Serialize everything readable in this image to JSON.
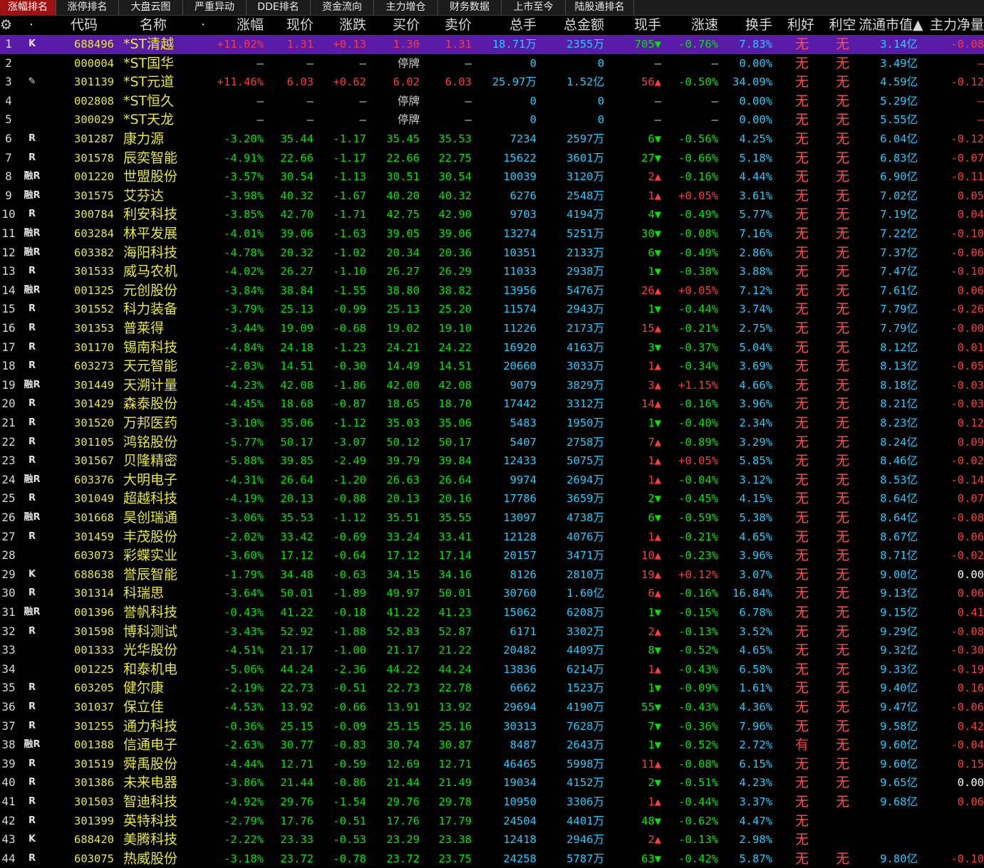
{
  "tabs": [
    {
      "label": "涨幅排名",
      "active": true
    },
    {
      "label": "涨停排名",
      "active": false
    },
    {
      "label": "大盘云图",
      "active": false
    },
    {
      "label": "严重异动",
      "active": false
    },
    {
      "label": "DDE排名",
      "active": false
    },
    {
      "label": "资金流向",
      "active": false
    },
    {
      "label": "主力增仓",
      "active": false
    },
    {
      "label": "财务数据",
      "active": false
    },
    {
      "label": "上市至今",
      "active": false
    },
    {
      "label": "陆股通排名",
      "active": false
    }
  ],
  "header": {
    "settings_icon": "gear-icon",
    "columns": [
      "",
      "·",
      "代码",
      "名称",
      "·",
      "涨幅",
      "现价",
      "涨跌",
      "买价",
      "卖价",
      "总手",
      "总金额",
      "现手",
      "涨速",
      "换手",
      "利好",
      "利空",
      "流通市值▲",
      "主力净量"
    ]
  },
  "colors": {
    "up": "#ff3838",
    "down": "#00e600",
    "code": "#e8e838",
    "name": "#e8e838",
    "value": "#22ccff",
    "flat": "#d0d0d0",
    "selected_bg": "#5a1ba8",
    "active_tab": "#9e1212"
  },
  "rows": [
    [
      "1",
      "K",
      "688496",
      "*ST清越",
      "+11.02%",
      "1.31",
      "+0.13",
      "1.30",
      "1.31",
      "18.71万",
      "2355万",
      "705▼",
      "-0.76%",
      "7.83%",
      "无",
      "无",
      "3.14亿",
      "-0.08"
    ],
    [
      "2",
      "",
      "000004",
      "*ST国华",
      "—",
      "—",
      "—",
      "停牌",
      "—",
      "0",
      "0",
      "—",
      "—",
      "0.00%",
      "无",
      "无",
      "3.49亿",
      "—"
    ],
    [
      "3",
      "✎",
      "301139",
      "*ST元道",
      "+11.46%",
      "6.03",
      "+0.62",
      "6.02",
      "6.03",
      "25.97万",
      "1.52亿",
      "56▲",
      "-0.50%",
      "34.09%",
      "无",
      "无",
      "4.59亿",
      "-0.12"
    ],
    [
      "4",
      "",
      "002808",
      "*ST恒久",
      "—",
      "—",
      "—",
      "停牌",
      "—",
      "0",
      "0",
      "—",
      "—",
      "0.00%",
      "无",
      "无",
      "5.29亿",
      "—"
    ],
    [
      "5",
      "",
      "300029",
      "*ST天龙",
      "—",
      "—",
      "—",
      "停牌",
      "—",
      "0",
      "0",
      "—",
      "—",
      "0.00%",
      "无",
      "无",
      "5.55亿",
      "—"
    ],
    [
      "6",
      "R",
      "301287",
      "康力源",
      "-3.20%",
      "35.44",
      "-1.17",
      "35.45",
      "35.53",
      "7234",
      "2597万",
      "6▼",
      "-0.56%",
      "4.25%",
      "无",
      "无",
      "6.04亿",
      "-0.12"
    ],
    [
      "7",
      "R",
      "301578",
      "辰奕智能",
      "-4.91%",
      "22.66",
      "-1.17",
      "22.66",
      "22.75",
      "15622",
      "3601万",
      "27▼",
      "-0.66%",
      "5.18%",
      "无",
      "无",
      "6.83亿",
      "-0.07"
    ],
    [
      "8",
      "融R",
      "001220",
      "世盟股份",
      "-3.57%",
      "30.54",
      "-1.13",
      "30.51",
      "30.54",
      "10039",
      "3120万",
      "2▲",
      "-0.16%",
      "4.44%",
      "无",
      "无",
      "6.90亿",
      "-0.11"
    ],
    [
      "9",
      "融R",
      "301575",
      "艾芬达",
      "-3.98%",
      "40.32",
      "-1.67",
      "40.20",
      "40.32",
      "6276",
      "2548万",
      "1▲",
      "+0.05%",
      "3.61%",
      "无",
      "无",
      "7.02亿",
      "0.05"
    ],
    [
      "10",
      "R",
      "300784",
      "利安科技",
      "-3.85%",
      "42.70",
      "-1.71",
      "42.75",
      "42.90",
      "9703",
      "4194万",
      "4▼",
      "-0.49%",
      "5.77%",
      "无",
      "无",
      "7.19亿",
      "0.04"
    ],
    [
      "11",
      "融R",
      "603284",
      "林平发展",
      "-4.01%",
      "39.06",
      "-1.63",
      "39.05",
      "39.06",
      "13274",
      "5251万",
      "30▼",
      "-0.08%",
      "7.16%",
      "无",
      "无",
      "7.22亿",
      "-0.10"
    ],
    [
      "12",
      "融R",
      "603382",
      "海阳科技",
      "-4.78%",
      "20.32",
      "-1.02",
      "20.34",
      "20.36",
      "10351",
      "2133万",
      "6▼",
      "-0.49%",
      "2.86%",
      "无",
      "无",
      "7.37亿",
      "-0.06"
    ],
    [
      "13",
      "R",
      "301533",
      "威马农机",
      "-4.02%",
      "26.27",
      "-1.10",
      "26.27",
      "26.29",
      "11033",
      "2938万",
      "1▼",
      "-0.38%",
      "3.88%",
      "无",
      "无",
      "7.47亿",
      "-0.10"
    ],
    [
      "14",
      "融R",
      "001325",
      "元创股份",
      "-3.84%",
      "38.84",
      "-1.55",
      "38.80",
      "38.82",
      "13956",
      "5476万",
      "26▲",
      "+0.05%",
      "7.12%",
      "无",
      "无",
      "7.61亿",
      "0.06"
    ],
    [
      "15",
      "R",
      "301552",
      "科力装备",
      "-3.79%",
      "25.13",
      "-0.99",
      "25.13",
      "25.20",
      "11574",
      "2943万",
      "1▼",
      "-0.44%",
      "3.74%",
      "无",
      "无",
      "7.79亿",
      "-0.26"
    ],
    [
      "16",
      "R",
      "301353",
      "普莱得",
      "-3.44%",
      "19.09",
      "-0.68",
      "19.02",
      "19.10",
      "11226",
      "2173万",
      "15▲",
      "-0.21%",
      "2.75%",
      "无",
      "无",
      "7.79亿",
      "-0.00"
    ],
    [
      "17",
      "R",
      "301170",
      "锡南科技",
      "-4.84%",
      "24.18",
      "-1.23",
      "24.21",
      "24.22",
      "16920",
      "4163万",
      "3▼",
      "-0.37%",
      "5.04%",
      "无",
      "无",
      "8.12亿",
      "0.01"
    ],
    [
      "18",
      "R",
      "603273",
      "天元智能",
      "-2.03%",
      "14.51",
      "-0.30",
      "14.49",
      "14.51",
      "20660",
      "3033万",
      "1▲",
      "-0.34%",
      "3.69%",
      "无",
      "无",
      "8.13亿",
      "-0.05"
    ],
    [
      "19",
      "融R",
      "301449",
      "天溯计量",
      "-4.23%",
      "42.08",
      "-1.86",
      "42.00",
      "42.08",
      "9079",
      "3829万",
      "3▲",
      "+1.15%",
      "4.66%",
      "无",
      "无",
      "8.18亿",
      "-0.03"
    ],
    [
      "20",
      "R",
      "301429",
      "森泰股份",
      "-4.45%",
      "18.68",
      "-0.87",
      "18.65",
      "18.70",
      "17442",
      "3312万",
      "14▲",
      "-0.16%",
      "3.96%",
      "无",
      "无",
      "8.21亿",
      "-0.03"
    ],
    [
      "21",
      "R",
      "301520",
      "万邦医药",
      "-3.10%",
      "35.06",
      "-1.12",
      "35.03",
      "35.06",
      "5483",
      "1950万",
      "1▼",
      "-0.40%",
      "2.34%",
      "无",
      "无",
      "8.23亿",
      "0.12"
    ],
    [
      "22",
      "R",
      "301105",
      "鸿铭股份",
      "-5.77%",
      "50.17",
      "-3.07",
      "50.12",
      "50.17",
      "5407",
      "2758万",
      "7▲",
      "-0.89%",
      "3.29%",
      "无",
      "无",
      "8.24亿",
      "0.09"
    ],
    [
      "23",
      "R",
      "301567",
      "贝隆精密",
      "-5.88%",
      "39.85",
      "-2.49",
      "39.79",
      "39.84",
      "12433",
      "5075万",
      "1▲",
      "+0.05%",
      "5.85%",
      "无",
      "无",
      "8.46亿",
      "-0.02"
    ],
    [
      "24",
      "融R",
      "603376",
      "大明电子",
      "-4.31%",
      "26.64",
      "-1.20",
      "26.63",
      "26.64",
      "9974",
      "2694万",
      "1▲",
      "-0.04%",
      "3.12%",
      "无",
      "无",
      "8.53亿",
      "-0.14"
    ],
    [
      "25",
      "R",
      "301049",
      "超越科技",
      "-4.19%",
      "20.13",
      "-0.88",
      "20.13",
      "20.16",
      "17786",
      "3659万",
      "2▼",
      "-0.45%",
      "4.15%",
      "无",
      "无",
      "8.64亿",
      "0.07"
    ],
    [
      "26",
      "融R",
      "301668",
      "昊创瑞通",
      "-3.06%",
      "35.53",
      "-1.12",
      "35.51",
      "35.55",
      "13097",
      "4738万",
      "6▼",
      "-0.59%",
      "5.38%",
      "无",
      "无",
      "8.64亿",
      "-0.08"
    ],
    [
      "27",
      "R",
      "301459",
      "丰茂股份",
      "-2.02%",
      "33.42",
      "-0.69",
      "33.24",
      "33.41",
      "12128",
      "4076万",
      "1▲",
      "-0.21%",
      "4.65%",
      "无",
      "无",
      "8.67亿",
      "0.06"
    ],
    [
      "28",
      "",
      "603073",
      "彩蝶实业",
      "-3.60%",
      "17.12",
      "-0.64",
      "17.12",
      "17.14",
      "20157",
      "3471万",
      "10▲",
      "-0.23%",
      "3.96%",
      "无",
      "无",
      "8.71亿",
      "-0.02"
    ],
    [
      "29",
      "K",
      "688638",
      "誉辰智能",
      "-1.79%",
      "34.48",
      "-0.63",
      "34.15",
      "34.16",
      "8126",
      "2810万",
      "19▲",
      "+0.12%",
      "3.07%",
      "无",
      "无",
      "9.00亿",
      "0.00"
    ],
    [
      "30",
      "R",
      "301314",
      "科瑞思",
      "-3.64%",
      "50.01",
      "-1.89",
      "49.97",
      "50.01",
      "30760",
      "1.60亿",
      "6▲",
      "-0.16%",
      "16.84%",
      "无",
      "无",
      "9.13亿",
      "0.06"
    ],
    [
      "31",
      "融R",
      "001396",
      "誉帆科技",
      "-0.43%",
      "41.22",
      "-0.18",
      "41.22",
      "41.23",
      "15062",
      "6208万",
      "1▼",
      "-0.15%",
      "6.78%",
      "无",
      "无",
      "9.15亿",
      "0.41"
    ],
    [
      "32",
      "R",
      "301598",
      "博科测试",
      "-3.43%",
      "52.92",
      "-1.88",
      "52.83",
      "52.87",
      "6171",
      "3302万",
      "2▲",
      "-0.13%",
      "3.52%",
      "无",
      "无",
      "9.29亿",
      "-0.08"
    ],
    [
      "33",
      "",
      "001333",
      "光华股份",
      "-4.51%",
      "21.17",
      "-1.00",
      "21.17",
      "21.22",
      "20482",
      "4409万",
      "8▼",
      "-0.52%",
      "4.65%",
      "无",
      "无",
      "9.32亿",
      "-0.30"
    ],
    [
      "34",
      "",
      "001225",
      "和泰机电",
      "-5.06%",
      "44.24",
      "-2.36",
      "44.22",
      "44.24",
      "13836",
      "6214万",
      "1▲",
      "-0.43%",
      "6.58%",
      "无",
      "无",
      "9.33亿",
      "-0.19"
    ],
    [
      "35",
      "R",
      "603205",
      "健尔康",
      "-2.19%",
      "22.73",
      "-0.51",
      "22.73",
      "22.78",
      "6662",
      "1523万",
      "1▼",
      "-0.09%",
      "1.61%",
      "无",
      "无",
      "9.40亿",
      "0.16"
    ],
    [
      "36",
      "R",
      "301037",
      "保立佳",
      "-4.53%",
      "13.92",
      "-0.66",
      "13.91",
      "13.92",
      "29694",
      "4190万",
      "55▼",
      "-0.43%",
      "4.36%",
      "无",
      "无",
      "9.47亿",
      "-0.06"
    ],
    [
      "37",
      "R",
      "301255",
      "通力科技",
      "-0.36%",
      "25.15",
      "-0.09",
      "25.15",
      "25.16",
      "30313",
      "7628万",
      "7▼",
      "-0.36%",
      "7.96%",
      "无",
      "无",
      "9.58亿",
      "0.42"
    ],
    [
      "38",
      "融R",
      "001388",
      "信通电子",
      "-2.63%",
      "30.77",
      "-0.83",
      "30.74",
      "30.87",
      "8487",
      "2643万",
      "1▼",
      "-0.52%",
      "2.72%",
      "有",
      "无",
      "9.60亿",
      "-0.04"
    ],
    [
      "39",
      "R",
      "301519",
      "舜禹股份",
      "-4.44%",
      "12.71",
      "-0.59",
      "12.69",
      "12.71",
      "46465",
      "5998万",
      "11▲",
      "-0.08%",
      "6.15%",
      "无",
      "无",
      "9.60亿",
      "0.15"
    ],
    [
      "40",
      "R",
      "301386",
      "未来电器",
      "-3.86%",
      "21.44",
      "-0.86",
      "21.44",
      "21.49",
      "19034",
      "4152万",
      "2▼",
      "-0.51%",
      "4.23%",
      "无",
      "无",
      "9.65亿",
      "0.00"
    ],
    [
      "41",
      "R",
      "301503",
      "智迪科技",
      "-4.92%",
      "29.76",
      "-1.54",
      "29.76",
      "29.78",
      "10950",
      "3306万",
      "1▲",
      "-0.44%",
      "3.37%",
      "无",
      "无",
      "9.68亿",
      "0.06"
    ],
    [
      "42",
      "R",
      "301399",
      "英特科技",
      "-2.79%",
      "17.76",
      "-0.51",
      "17.76",
      "17.79",
      "24504",
      "4401万",
      "48▼",
      "-0.62%",
      "4.47%",
      "无",
      "",
      "",
      ""
    ],
    [
      "43",
      "K",
      "688420",
      "美腾科技",
      "-2.22%",
      "23.33",
      "-0.53",
      "23.29",
      "23.38",
      "12418",
      "2946万",
      "2▲",
      "-0.13%",
      "2.98%",
      "无",
      "",
      "",
      ""
    ],
    [
      "44",
      "R",
      "603075",
      "热威股份",
      "-3.18%",
      "23.72",
      "-0.78",
      "23.72",
      "23.75",
      "24258",
      "5787万",
      "63▼",
      "-0.42%",
      "5.87%",
      "无",
      "无",
      "9.80亿",
      "-0.10"
    ]
  ]
}
